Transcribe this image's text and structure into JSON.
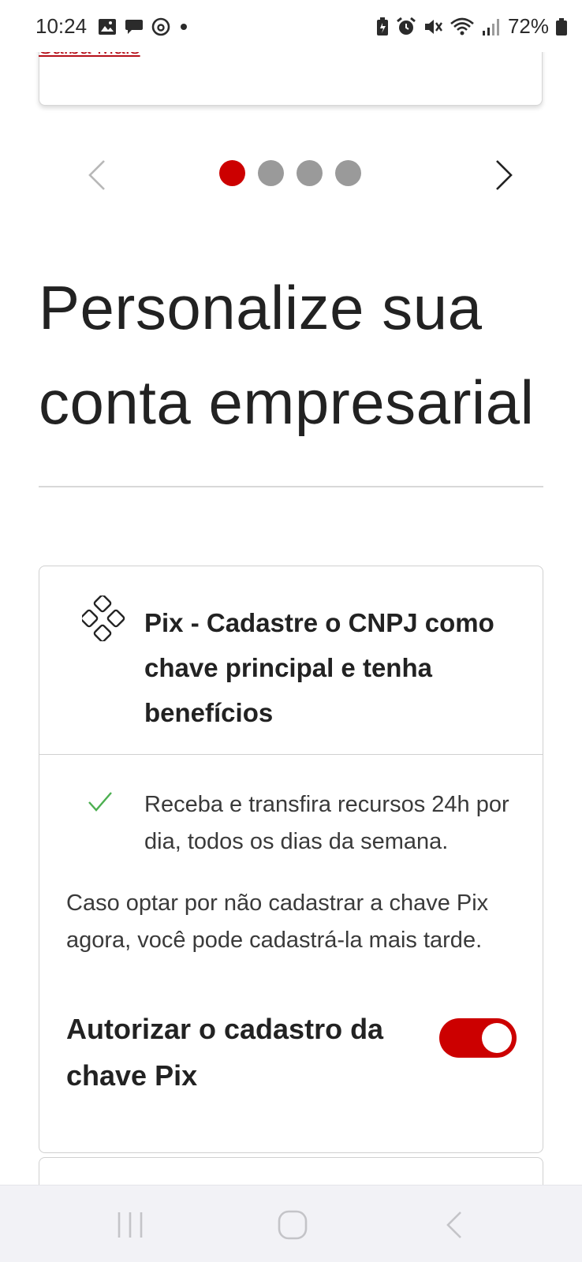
{
  "status_bar": {
    "time": "10:24",
    "battery_percent": "72%",
    "left_icons": [
      "gallery-icon",
      "chat-bubble-icon",
      "threads-icon",
      "dot-icon"
    ],
    "right_icons": [
      "battery-saver-icon",
      "alarm-icon",
      "mute-icon",
      "wifi-icon",
      "signal-icon",
      "battery-icon"
    ]
  },
  "previous_card": {
    "link_text": "Saiba Mais"
  },
  "carousel": {
    "total_slides": 4,
    "active_slide": 1,
    "active_color": "#cc0000",
    "inactive_color": "#9a9a9a"
  },
  "page": {
    "title_line1": "Personalize sua",
    "title_line2": "conta empresarial"
  },
  "pix_card": {
    "icon": "pix-icon",
    "title": "Pix - Cadastre o CNPJ como chave principal e tenha benefícios",
    "benefit_icon": "checkmark-icon",
    "benefit_text": "Receba e transfira recursos 24h por dia, todos os dias da semana.",
    "info_text": "Caso optar por não cadastrar a chave Pix agora, você pode cadastrá-la mais tarde.",
    "toggle_label": "Autorizar o cadastro da chave Pix",
    "toggle_on": true,
    "accent_color": "#cc0000",
    "check_color": "#4caf50"
  },
  "nav_bar": {
    "buttons": [
      "recent-apps-icon",
      "home-icon",
      "back-icon"
    ]
  }
}
